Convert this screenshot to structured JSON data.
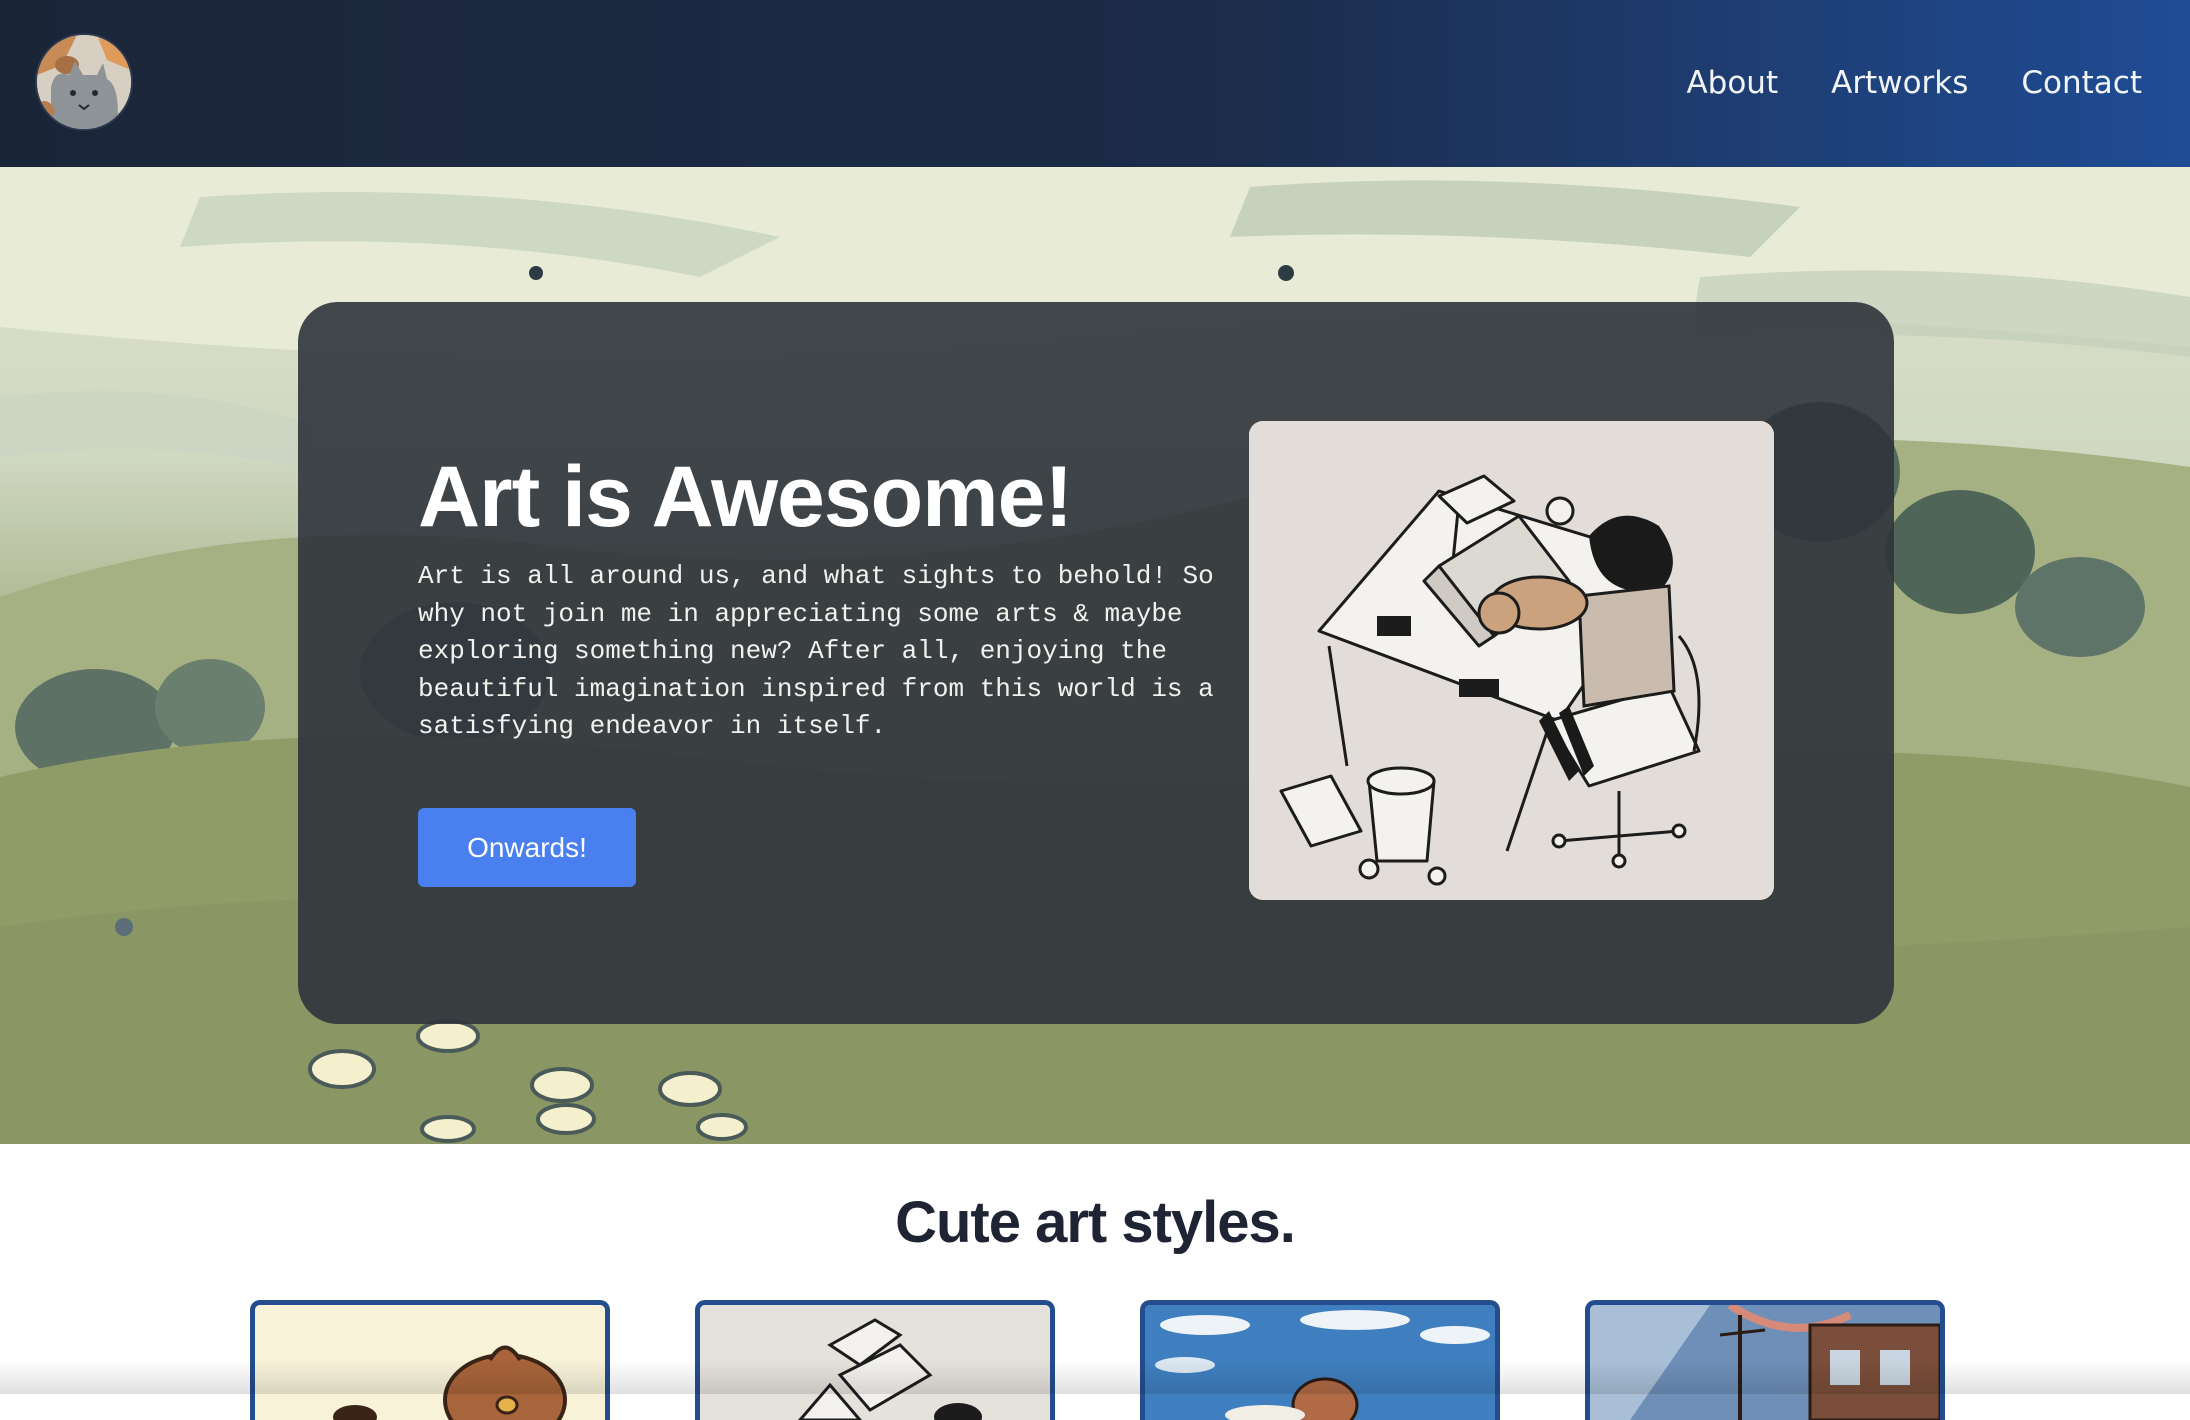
{
  "nav": {
    "logo_icon": "cat-avatar-icon",
    "links": [
      {
        "label": "About"
      },
      {
        "label": "Artworks"
      },
      {
        "label": "Contact"
      }
    ]
  },
  "hero": {
    "title": "Art is Awesome!",
    "body": "Art is all around us, and what sights to behold! So why not join me in appreciating some arts & maybe exploring something new? After all, enjoying the beautiful imagination inspired from this world is a satisfying endeavor in itself.",
    "button_label": "Onwards!",
    "image_icon": "artist-at-desk-illustration"
  },
  "gallery": {
    "title": "Cute art styles.",
    "items": [
      {
        "icon": "brown-bird-artwork"
      },
      {
        "icon": "desk-sketch-artwork"
      },
      {
        "icon": "sky-creature-artwork"
      },
      {
        "icon": "city-street-artwork"
      }
    ]
  },
  "colors": {
    "nav_start": "#1b2538",
    "nav_end": "#1f4c95",
    "button": "#4a7ff0",
    "thumb_border": "#234d8f"
  }
}
